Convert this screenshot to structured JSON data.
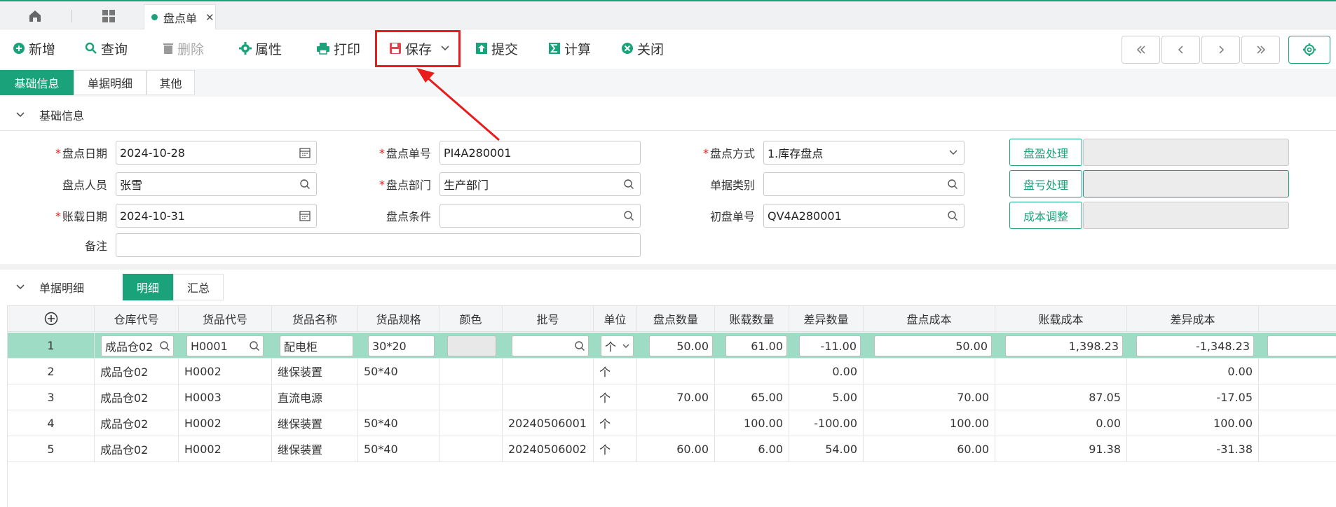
{
  "tabs": {
    "active_doc": "盘点单"
  },
  "toolbar": {
    "add": "新增",
    "query": "查询",
    "delete": "删除",
    "props": "属性",
    "print": "打印",
    "save": "保存",
    "submit": "提交",
    "calc": "计算",
    "close": "关闭"
  },
  "main_tabs": [
    "基础信息",
    "单据明细",
    "其他"
  ],
  "sections": {
    "basic": "基础信息",
    "detail": "单据明细"
  },
  "form": {
    "count_date_label": "盘点日期",
    "count_date": "2024-10-28",
    "count_no_label": "盘点单号",
    "count_no": "PI4A280001",
    "count_method_label": "盘点方式",
    "count_method": "1.库存盘点",
    "counter_label": "盘点人员",
    "counter": "张雪",
    "count_dept_label": "盘点部门",
    "count_dept": "生产部门",
    "doc_type_label": "单据类别",
    "doc_type": "",
    "ledger_date_label": "账载日期",
    "ledger_date": "2024-10-31",
    "count_cond_label": "盘点条件",
    "count_cond": "",
    "init_no_label": "初盘单号",
    "init_no": "QV4A280001",
    "remark_label": "备注",
    "remark": ""
  },
  "side_buttons": {
    "surplus": "盘盈处理",
    "loss": "盘亏处理",
    "cost_adj": "成本调整"
  },
  "sub_tabs": [
    "明细",
    "汇总"
  ],
  "grid": {
    "headers": [
      "仓库代号",
      "货品代号",
      "货品名称",
      "货品规格",
      "颜色",
      "批号",
      "单位",
      "盘点数量",
      "账载数量",
      "差异数量",
      "盘点成本",
      "账载成本",
      "差异成本"
    ],
    "rows": [
      [
        "1",
        "成品仓02",
        "H0001",
        "配电柜",
        "30*20",
        "",
        "",
        "个",
        "50.00",
        "61.00",
        "-11.00",
        "50.00",
        "1,398.23",
        "-1,348.23"
      ],
      [
        "2",
        "成品仓02",
        "H0002",
        "继保装置",
        "50*40",
        "",
        "",
        "个",
        "",
        "",
        "0.00",
        "",
        "",
        "0.00"
      ],
      [
        "3",
        "成品仓02",
        "H0003",
        "直流电源",
        "",
        "",
        "",
        "个",
        "70.00",
        "65.00",
        "5.00",
        "70.00",
        "87.05",
        "-17.05"
      ],
      [
        "4",
        "成品仓02",
        "H0002",
        "继保装置",
        "50*40",
        "",
        "20240506001",
        "个",
        "",
        "100.00",
        "-100.00",
        "100.00",
        "0.00",
        "100.00"
      ],
      [
        "5",
        "成品仓02",
        "H0002",
        "继保装置",
        "50*40",
        "",
        "20240506002",
        "个",
        "60.00",
        "6.00",
        "54.00",
        "60.00",
        "91.38",
        "-31.38"
      ]
    ]
  },
  "colors": {
    "accent": "#1aa37a",
    "highlight": "#e81c1c",
    "selected_row": "#9fdcc5"
  }
}
